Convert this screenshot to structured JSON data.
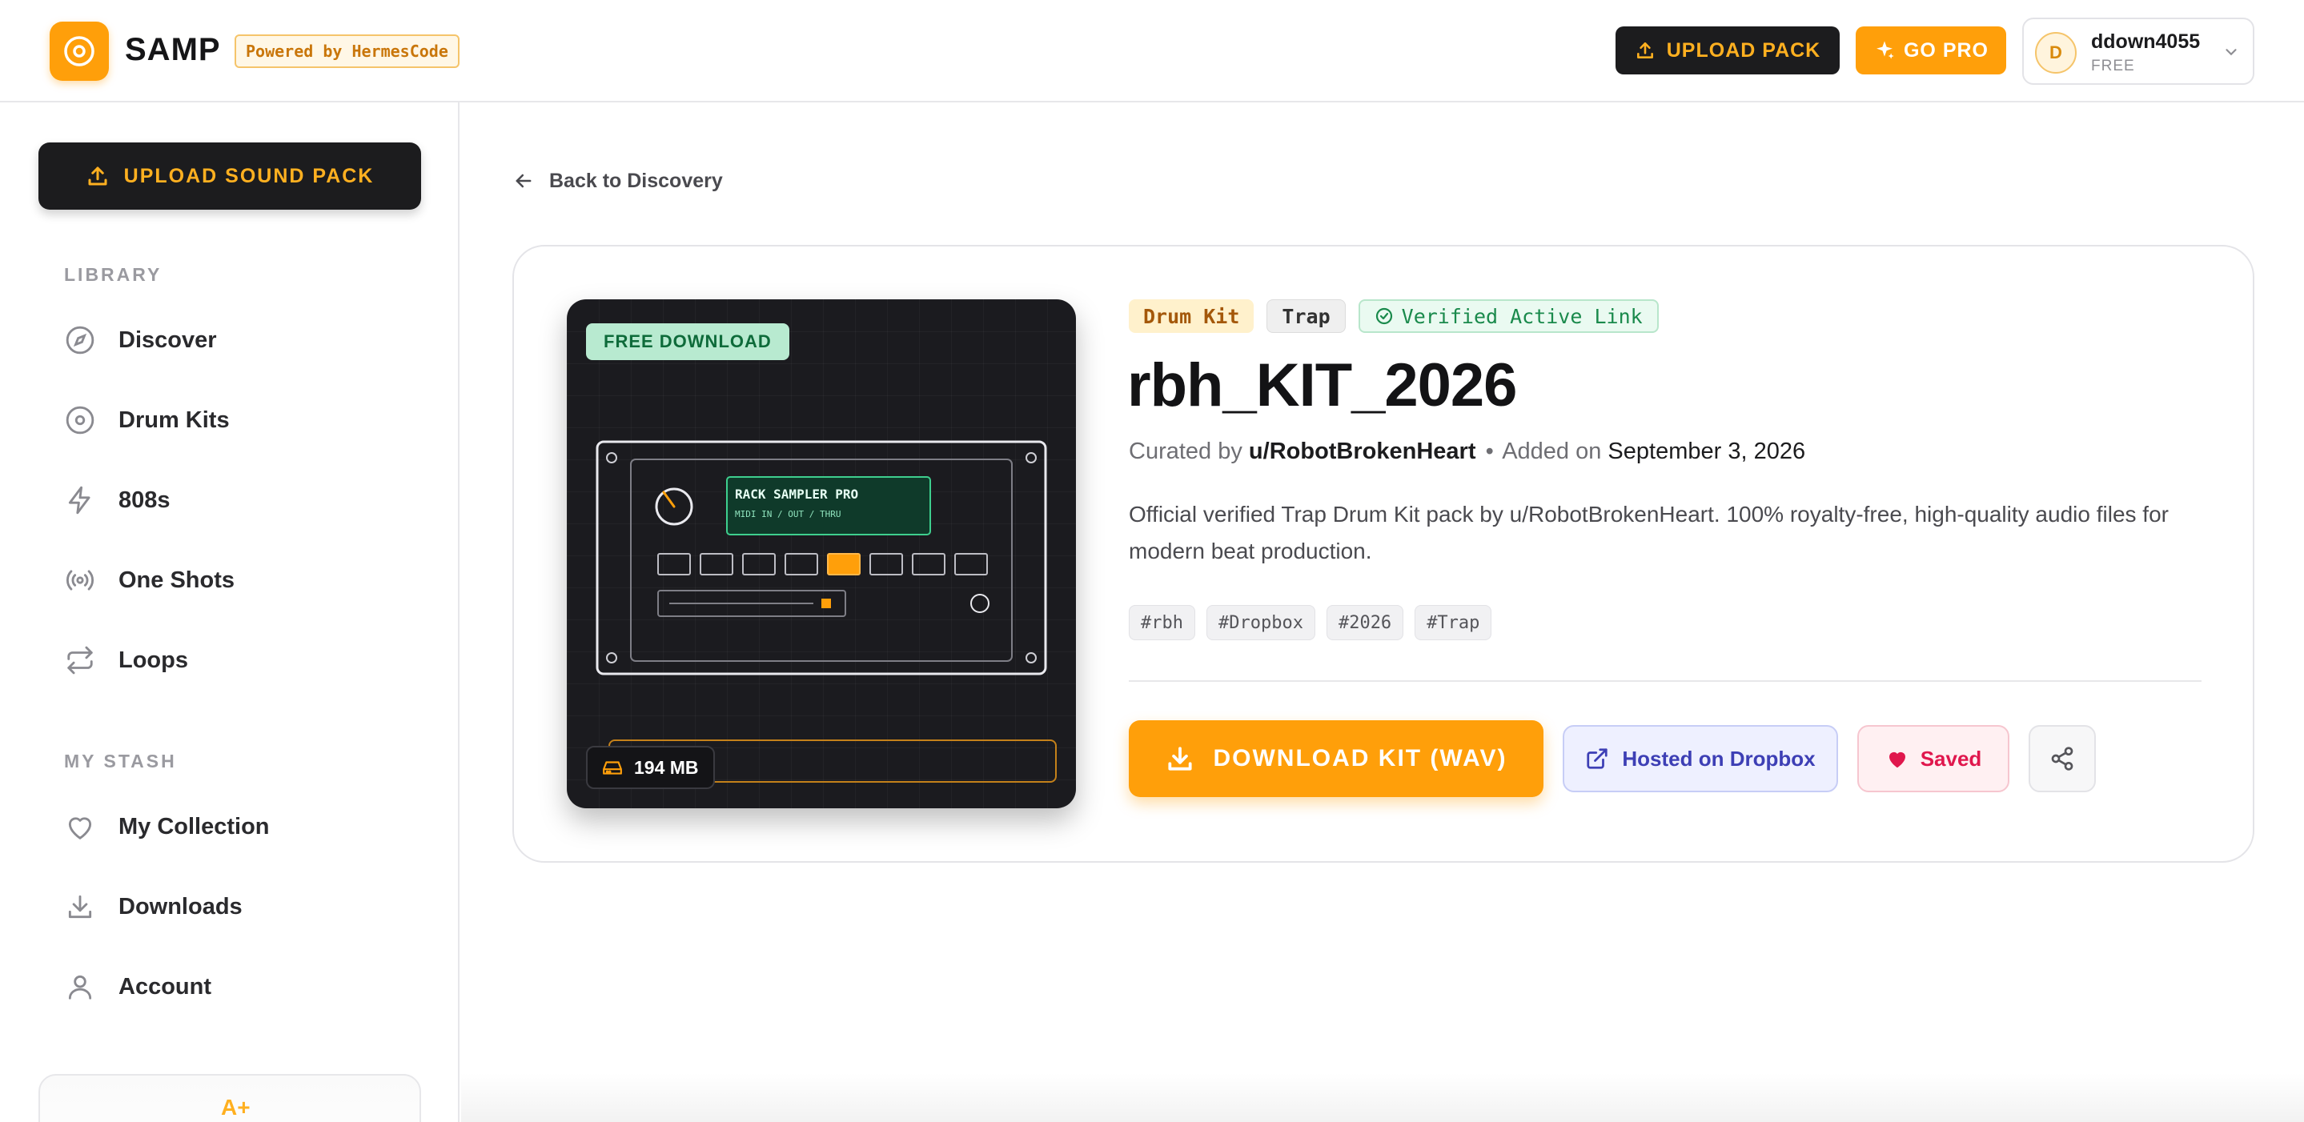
{
  "brand": {
    "name": "SAMP",
    "powered_by": "Powered by HermesCode",
    "accent": "#ff9f0a",
    "dark": "#1c1c1e"
  },
  "header": {
    "upload_pack_label": "UPLOAD PACK",
    "go_pro_label": "GO PRO",
    "user": {
      "initial": "D",
      "name": "ddown4055",
      "plan": "FREE"
    }
  },
  "sidebar": {
    "upload_label": "UPLOAD SOUND PACK",
    "library_heading": "LIBRARY",
    "library_items": [
      {
        "label": "Discover",
        "icon": "compass-icon"
      },
      {
        "label": "Drum Kits",
        "icon": "disc-icon"
      },
      {
        "label": "808s",
        "icon": "lightning-icon"
      },
      {
        "label": "One Shots",
        "icon": "broadcast-icon"
      },
      {
        "label": "Loops",
        "icon": "repeat-icon"
      }
    ],
    "stash_heading": "MY STASH",
    "stash_items": [
      {
        "label": "My Collection",
        "icon": "heart-icon"
      },
      {
        "label": "Downloads",
        "icon": "download-icon"
      },
      {
        "label": "Account",
        "icon": "user-icon"
      }
    ]
  },
  "main": {
    "back_label": "Back to Discovery",
    "cover": {
      "badge": "FREE DOWNLOAD",
      "rack_title": "RACK SAMPLER PRO",
      "rack_subtitle": "MIDI IN / OUT / THRU",
      "size": "194 MB"
    },
    "tags": {
      "genre": "Drum Kit",
      "style": "Trap",
      "verified": "Verified Active Link"
    },
    "title": "rbh_KIT_2026",
    "byline": {
      "curated_prefix": "Curated by",
      "curator": "u/RobotBrokenHeart",
      "separator": "•",
      "added_prefix": "Added on",
      "date": "September 3, 2026"
    },
    "description": "Official verified Trap Drum Kit pack by u/RobotBrokenHeart. 100% royalty-free, high-quality audio files for modern beat production.",
    "hashtags": [
      "#rbh",
      "#Dropbox",
      "#2026",
      "#Trap"
    ],
    "actions": {
      "download_label": "DOWNLOAD KIT (WAV)",
      "hosted_label": "Hosted on Dropbox",
      "saved_label": "Saved",
      "share_icon": "share-icon"
    }
  }
}
